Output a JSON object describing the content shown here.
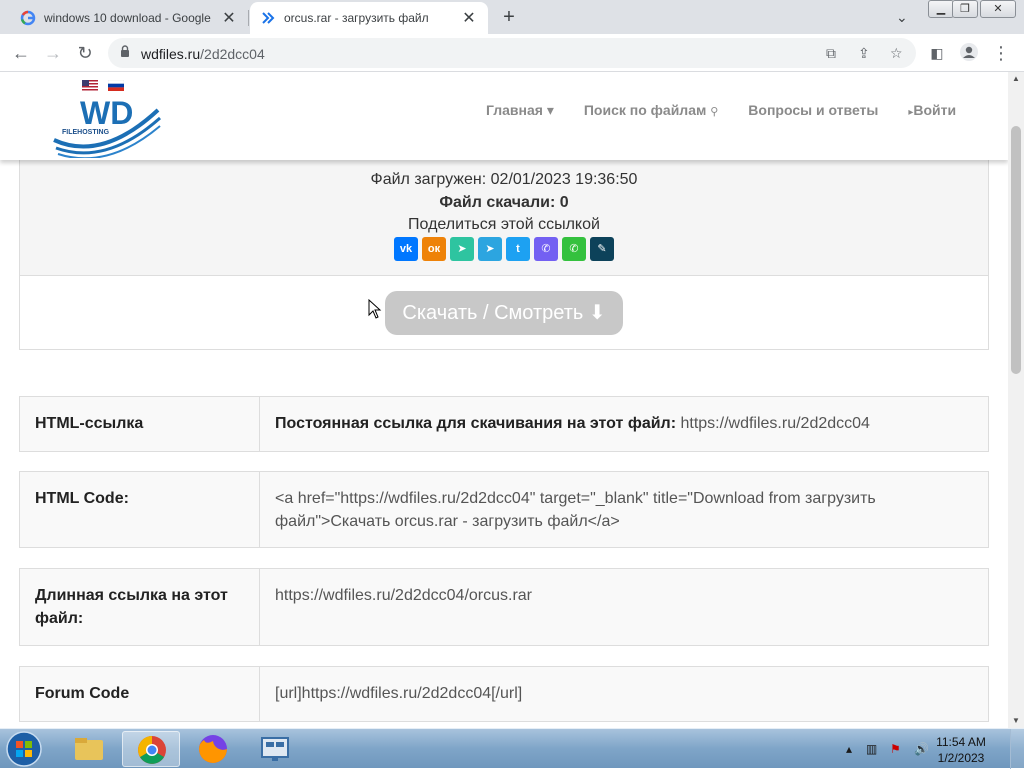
{
  "browser": {
    "tabs": [
      {
        "title": "windows 10 download - Google",
        "favicon": "google-icon",
        "close": "✕"
      },
      {
        "title": "orcus.rar - загрузить файл",
        "favicon": "wdfiles-icon",
        "close": "✕"
      }
    ],
    "new_tab": "+",
    "url_domain": "wdfiles.ru",
    "url_path": "/2d2dcc04",
    "colors": {
      "tabstrip": "#dee1e6",
      "omnibox": "#f1f3f4"
    }
  },
  "site": {
    "flags": [
      "us-flag",
      "ru-flag"
    ],
    "logo": {
      "big": "WD",
      "small": "FILEHOSTING"
    },
    "nav": [
      {
        "label": "Главная ▾",
        "icon": ""
      },
      {
        "label": "Поиск по файлам",
        "icon": "search-icon"
      },
      {
        "label": "Вопросы и ответы",
        "icon": ""
      },
      {
        "label": "Войти",
        "icon": "chevron-right-icon"
      }
    ],
    "nav_color": "#8a8a8a"
  },
  "file_info": {
    "uploaded_label": "Файл загружен:",
    "uploaded_value": "02/01/2023 19:36:50",
    "downloads_label": "Файл скачали:",
    "downloads_value": "0",
    "share_label": "Поделиться этой ссылкой",
    "social": [
      {
        "name": "vk",
        "glyph": "vk",
        "color": "#0077ff"
      },
      {
        "name": "odnoklassniki",
        "glyph": "ок",
        "color": "#ee8208"
      },
      {
        "name": "moimir",
        "glyph": "➤",
        "color": "#2ec4a0"
      },
      {
        "name": "telegram",
        "glyph": "➤",
        "color": "#2ca5e0"
      },
      {
        "name": "twitter",
        "glyph": "t",
        "color": "#1da1f2"
      },
      {
        "name": "viber",
        "glyph": "✆",
        "color": "#7360f2"
      },
      {
        "name": "whatsapp",
        "glyph": "✆",
        "color": "#34c13e"
      },
      {
        "name": "livejournal",
        "glyph": "✎",
        "color": "#0d425a"
      }
    ],
    "download_button": "Скачать / Смотреть ⬇"
  },
  "tables": [
    {
      "label": "HTML-ссылка",
      "value_bold": "Постоянная ссылка для скачивания на этот файл:",
      "value": " https://wdfiles.ru/2d2dcc04"
    },
    {
      "label": "HTML Code:",
      "value_bold": "",
      "value": "<a href=\"https://wdfiles.ru/2d2dcc04\" target=\"_blank\" title=\"Download from загрузить файл\">Скачать orcus.rar - загрузить файл</a>"
    },
    {
      "label": "Длинная ссылка на этот файл:",
      "value_bold": "",
      "value": "https://wdfiles.ru/2d2dcc04/orcus.rar"
    },
    {
      "label": "Forum Code",
      "value_bold": "",
      "value": "[url]https://wdfiles.ru/2d2dcc04[/url]"
    }
  ],
  "taskbar": {
    "apps": [
      "explorer-icon",
      "chrome-icon",
      "firefox-icon",
      "remote-desktop-icon"
    ],
    "clock_time": "11:54 AM",
    "clock_date": "1/2/2023"
  }
}
